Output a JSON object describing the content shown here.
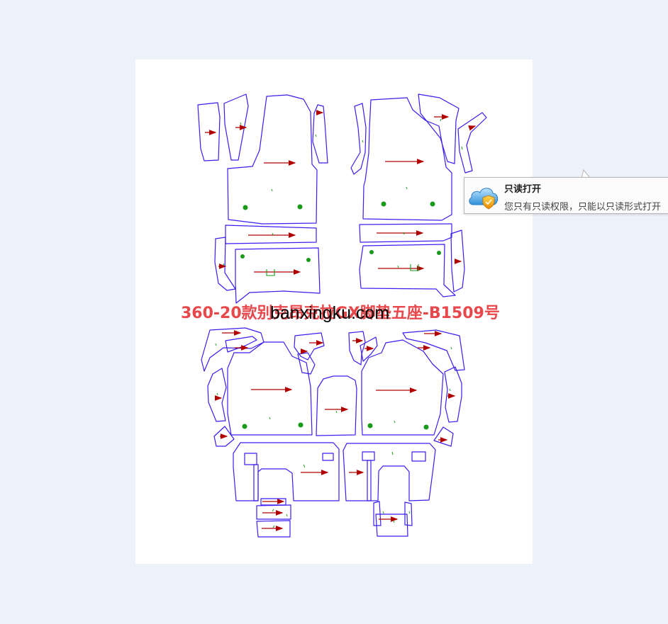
{
  "document": {
    "title": "360-20款别克昂克拉GX脚垫五座-B1509号",
    "watermark": "banxingku.com",
    "pattern_pieces": 26
  },
  "notification": {
    "title": "只读打开",
    "message": "您只有只读权限，只能以只读形式打开"
  },
  "colors": {
    "background": "#edf1f9",
    "page": "#ffffff",
    "outline": "#3a1ef0",
    "arrow": "#b00000",
    "marker": "#1a9a1a",
    "title": "#e8484c"
  }
}
